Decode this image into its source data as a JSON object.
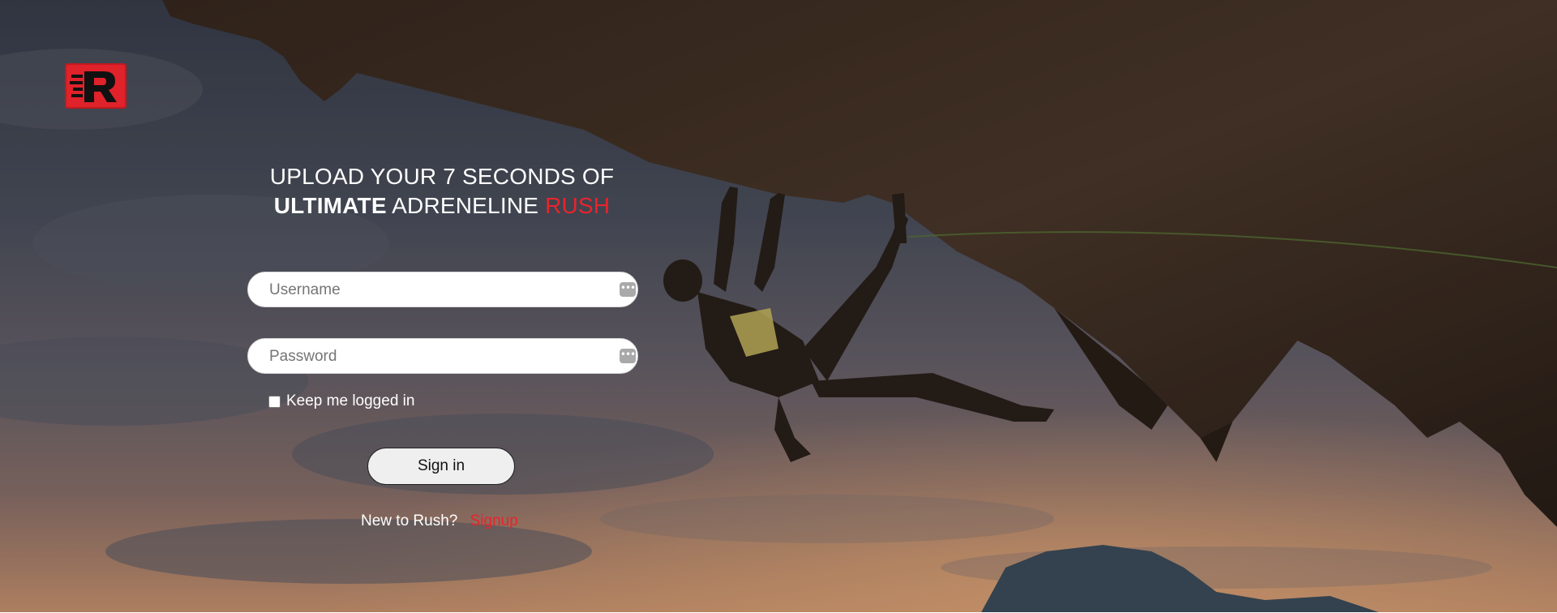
{
  "brand": {
    "logo_icon": "rush-r-logo-icon",
    "accent_color": "#e8242c"
  },
  "headline": {
    "line1": "UPLOAD YOUR 7 SECONDS OF",
    "bold_word": "ULTIMATE",
    "middle_word": "ADRENELINE",
    "accent_word": "RUSH"
  },
  "login": {
    "username_placeholder": "Username",
    "password_placeholder": "Password",
    "field_icon": "password-manager-key-icon",
    "field_icon_glyph": "•••",
    "remember_label": "Keep me logged in",
    "remember_checked": false,
    "signin_label": "Sign in"
  },
  "signup": {
    "prompt": "New to Rush?",
    "link_label": "Signup"
  },
  "colors": {
    "accent": "#e8242c",
    "button_bg": "#efefef",
    "text_light": "#ffffff"
  }
}
